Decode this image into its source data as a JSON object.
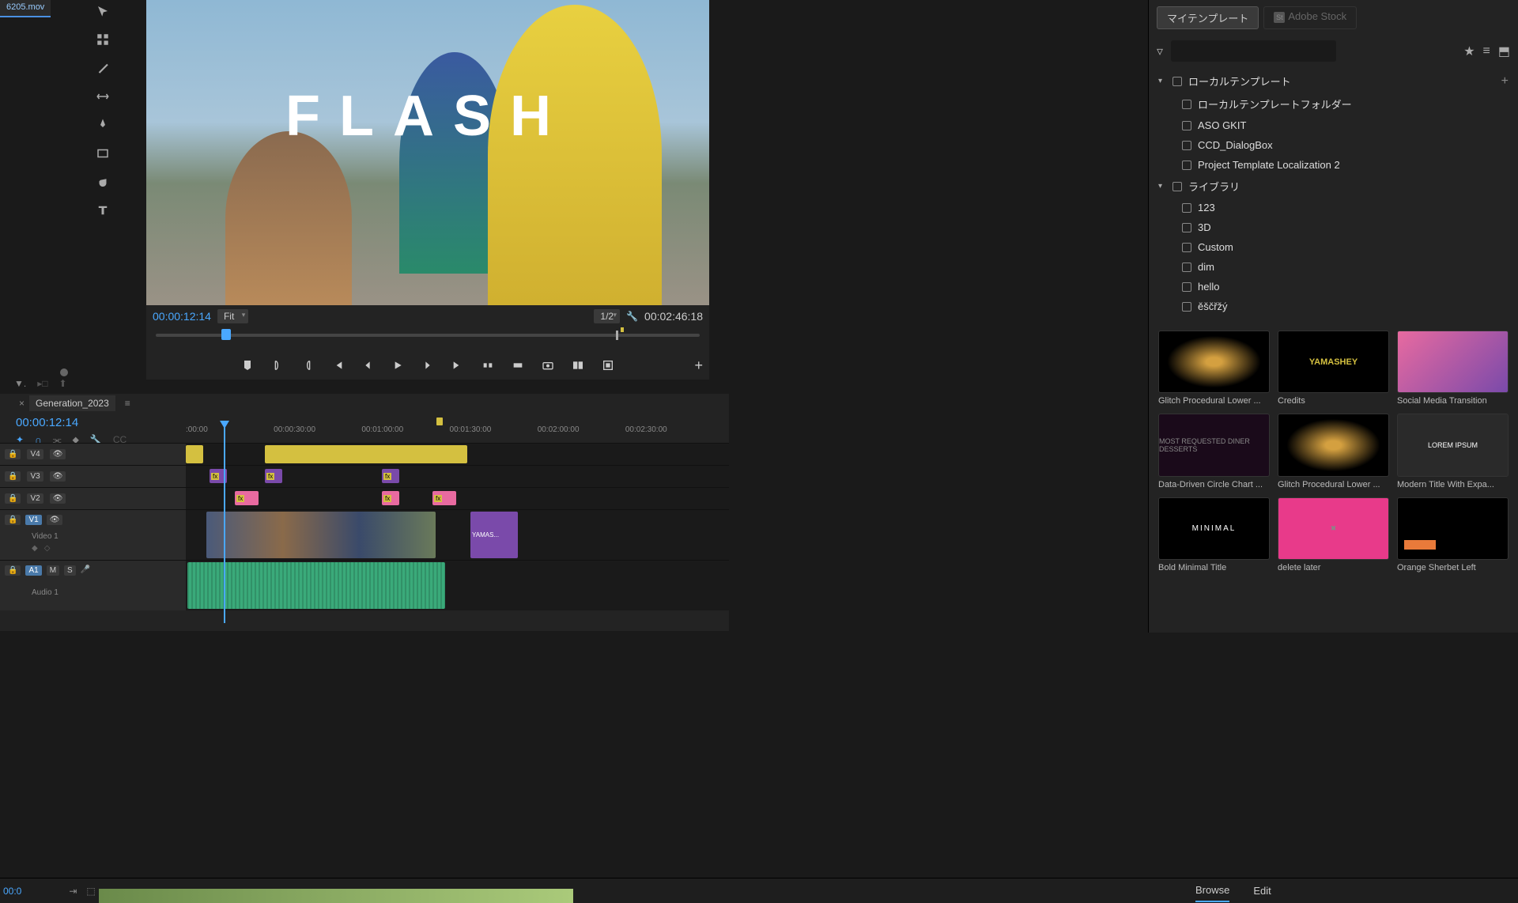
{
  "clipTab": "6205.mov",
  "programMonitor": {
    "overlayText": "FLASH",
    "leftTimecode": "00:00:12:14",
    "fitLabel": "Fit",
    "zoomLabel": "1/2",
    "rightTimecode": "00:02:46:18"
  },
  "timeline": {
    "sequenceName": "Generation_2023",
    "timecode": "00:00:12:14",
    "ruler": [
      ":00:00",
      "00:00:30:00",
      "00:01:00:00",
      "00:01:30:00",
      "00:02:00:00",
      "00:02:30:00"
    ],
    "tracks": {
      "v4": "V4",
      "v3": "V3",
      "v2": "V2",
      "v1": "V1",
      "v1label": "Video 1",
      "a1": "A1",
      "a1label": "Audio 1",
      "m": "M",
      "s": "S"
    }
  },
  "essentialGraphics": {
    "tabMyTemplates": "マイテンプレート",
    "tabStock": "Adobe Stock",
    "searchPlaceholder": "",
    "treeRoot1": "ローカルテンプレート",
    "treeItems1": [
      "ローカルテンプレートフォルダー",
      "ASO GKIT",
      "CCD_DialogBox",
      "Project Template Localization 2"
    ],
    "treeRoot2": "ライブラリ",
    "treeItems2": [
      "123",
      "3D",
      "Custom",
      "dim",
      "hello",
      "ěščřžý"
    ],
    "thumbs": [
      {
        "label": "Glitch Procedural Lower ...",
        "style": "dna"
      },
      {
        "label": "Credits",
        "style": "credits",
        "inner": "YAMASHEY"
      },
      {
        "label": "Social Media Transition",
        "style": "social"
      },
      {
        "label": "Data-Driven Circle Chart ...",
        "style": "circle",
        "inner": "MOST REQUESTED\nDINER DESSERTS"
      },
      {
        "label": "Glitch Procedural Lower ...",
        "style": "dna"
      },
      {
        "label": "Modern Title With Expa...",
        "style": "modern",
        "inner": "LOREM IPSUM"
      },
      {
        "label": "Bold Minimal Title",
        "style": "minimal",
        "inner": "MINIMAL"
      },
      {
        "label": "delete later",
        "style": "pink",
        "inner": "✖"
      },
      {
        "label": "Orange Sherbet Left",
        "style": "orange"
      }
    ]
  },
  "bottomTabs": {
    "browse": "Browse",
    "edit": "Edit"
  },
  "bottomTimecode": "00:0"
}
